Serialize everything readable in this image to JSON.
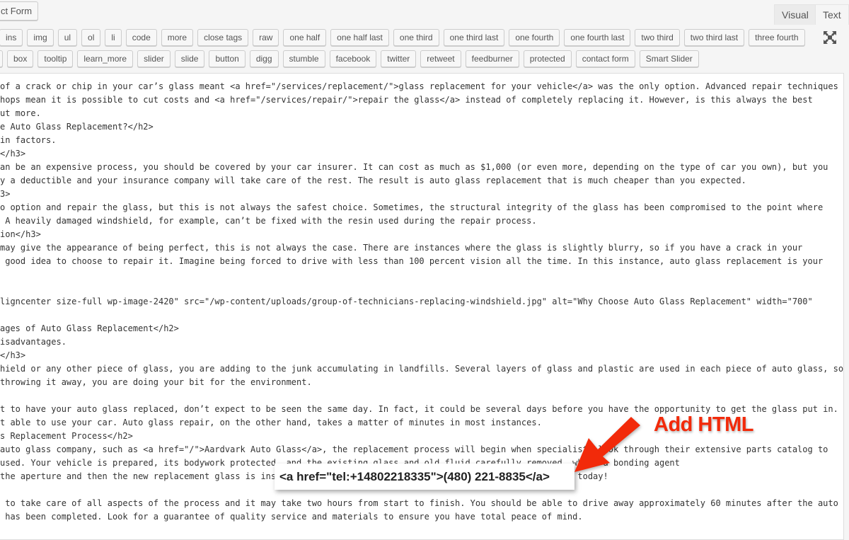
{
  "top_button": "ct Form",
  "tabs": {
    "visual": "Visual",
    "text": "Text"
  },
  "toolbar_row1": [
    "ins",
    "img",
    "ul",
    "ol",
    "li",
    "code",
    "more",
    "close tags",
    "raw",
    "one half",
    "one half last",
    "one third",
    "one third last",
    "one fourth",
    "one fourth last",
    "two third",
    "two third last",
    "three fourth"
  ],
  "toolbar_row2": [
    "",
    "box",
    "tooltip",
    "learn_more",
    "slider",
    "slide",
    "button",
    "digg",
    "stumble",
    "facebook",
    "twitter",
    "retweet",
    "feedburner",
    "protected",
    "contact form",
    "Smart Slider"
  ],
  "fullscreen_icon": "expand-arrows-icon",
  "editor_lines": [
    "of a crack or chip in your car’s glass meant <a href=\"/services/replacement/\">glass replacement for your vehicle</a> was the only option. Advanced repair techniques",
    "hops mean it is possible to cut costs and <a href=\"/services/repair/\">repair the glass</a> instead of completely replacing it. However, is this always the best",
    "ut more.",
    "e Auto Glass Replacement?</h2>",
    "in factors.",
    "</h3>",
    "an be an expensive process, you should be covered by your car insurer. It can cost as much as $1,000 (or even more, depending on the type of car you own), but you",
    "y a deductible and your insurance company will take care of the rest. The result is auto glass replacement that is much cheaper than you expected.",
    "3>",
    "o option and repair the glass, but this is not always the safest choice. Sometimes, the structural integrity of the glass has been compromised to the point where",
    " A heavily damaged windshield, for example, can’t be fixed with the resin used during the repair process.",
    "ion</h3>",
    "may give the appearance of being perfect, this is not always the case. There are instances where the glass is slightly blurry, so if you have a crack in your",
    " good idea to choose to repair it. Imagine being forced to drive with less than 100 percent vision all the time. In this instance, auto glass replacement is your",
    "",
    "",
    "ligncenter size-full wp-image-2420\" src=\"/wp-content/uploads/group-of-technicians-replacing-windshield.jpg\" alt=\"Why Choose Auto Glass Replacement\" width=\"700\"",
    "",
    "ages of Auto Glass Replacement</h2>",
    "isadvantages.",
    "</h3>",
    "hield or any other piece of glass, you are adding to the junk accumulating in landfills. Several layers of glass and plastic are used in each piece of auto glass, so",
    "throwing it away, you are doing your bit for the environment.",
    "",
    "t to have your auto glass replaced, don’t expect to be seen the same day. In fact, it could be several days before you have the opportunity to get the glass put in.",
    "t able to use your car. Auto glass repair, on the other hand, takes a matter of minutes in most instances.",
    "s Replacement Process</h2>",
    "auto glass company, such as <a href=\"/\">Aardvark Auto Glass</a>, the replacement process will begin when specialists look through their extensive parts catalog to",
    "used. Your vehicle is prepared, its bodywork protected, and the existing glass and old fluid carefully removed, while a bonding agent",
    "the aperture and then the new replacement glass is installed. Call <a href=\"tel:+14802218335\">(480) 221-8335</a> today!",
    "",
    " to take care of all aspects of the process and it may take two hours from start to finish. You should be able to drive away approximately 60 minutes after the auto",
    " has been completed. Look for a guarantee of quality service and materials to ensure you have total peace of mind."
  ],
  "overlay_snippet": "<a href=\"tel:+14802218335\">(480) 221-8835</a>",
  "callout": {
    "text": "Add HTML",
    "color": "#f22a0a",
    "icon": "arrow-icon"
  }
}
